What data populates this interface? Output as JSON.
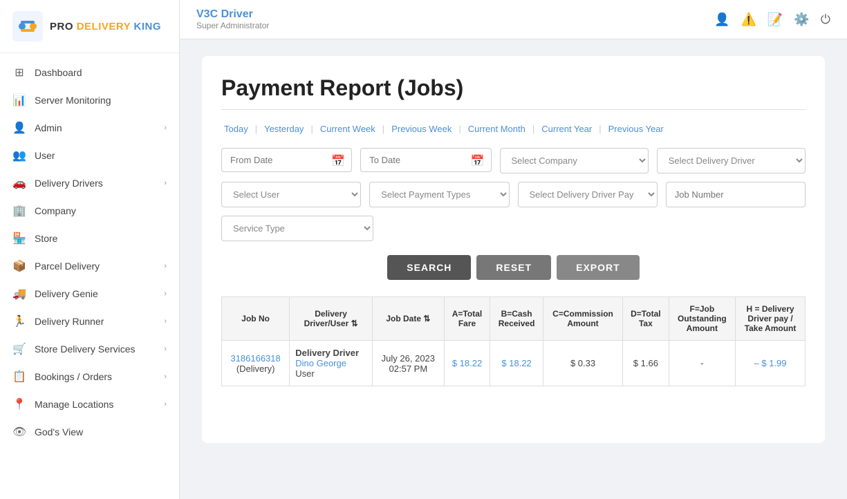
{
  "app": {
    "name_pro": "PRO",
    "name_delivery": "DELIVERY",
    "name_king": "KING"
  },
  "topbar": {
    "title": "V3C Driver",
    "subtitle": "Super Administrator"
  },
  "sidebar": {
    "items": [
      {
        "id": "dashboard",
        "label": "Dashboard",
        "icon": "⊞",
        "hasChevron": false
      },
      {
        "id": "server-monitoring",
        "label": "Server Monitoring",
        "icon": "📊",
        "hasChevron": false
      },
      {
        "id": "admin",
        "label": "Admin",
        "icon": "👤",
        "hasChevron": true
      },
      {
        "id": "user",
        "label": "User",
        "icon": "👥",
        "hasChevron": false
      },
      {
        "id": "delivery-drivers",
        "label": "Delivery Drivers",
        "icon": "🚗",
        "hasChevron": true
      },
      {
        "id": "company",
        "label": "Company",
        "icon": "🏢",
        "hasChevron": false
      },
      {
        "id": "store",
        "label": "Store",
        "icon": "🏪",
        "hasChevron": false
      },
      {
        "id": "parcel-delivery",
        "label": "Parcel Delivery",
        "icon": "📦",
        "hasChevron": true
      },
      {
        "id": "delivery-genie",
        "label": "Delivery Genie",
        "icon": "🚚",
        "hasChevron": true
      },
      {
        "id": "delivery-runner",
        "label": "Delivery Runner",
        "icon": "🏃",
        "hasChevron": true
      },
      {
        "id": "store-delivery-services",
        "label": "Store Delivery Services",
        "icon": "🛒",
        "hasChevron": true
      },
      {
        "id": "bookings-orders",
        "label": "Bookings / Orders",
        "icon": "📋",
        "hasChevron": true
      },
      {
        "id": "manage-locations",
        "label": "Manage Locations",
        "icon": "📍",
        "hasChevron": true
      },
      {
        "id": "gods-view",
        "label": "God's View",
        "icon": "👁",
        "hasChevron": false
      }
    ]
  },
  "page": {
    "title": "Payment Report (Jobs)"
  },
  "date_filters": [
    {
      "id": "today",
      "label": "Today"
    },
    {
      "id": "yesterday",
      "label": "Yesterday"
    },
    {
      "id": "current-week",
      "label": "Current Week"
    },
    {
      "id": "previous-week",
      "label": "Previous Week"
    },
    {
      "id": "current-month",
      "label": "Current Month"
    },
    {
      "id": "current-year",
      "label": "Current Year"
    },
    {
      "id": "previous-year",
      "label": "Previous Year"
    }
  ],
  "filters": {
    "from_date_placeholder": "From Date",
    "to_date_placeholder": "To Date",
    "select_company_placeholder": "Select Company",
    "select_delivery_driver_placeholder": "Select Delivery Driver",
    "select_user_placeholder": "Select User",
    "select_payment_types_placeholder": "Select Payment Types",
    "select_delivery_driver_pay_placeholder": "Select Delivery Driver Pay",
    "job_number_placeholder": "Job Number",
    "service_type_placeholder": "Service Type"
  },
  "buttons": {
    "search": "SEARCH",
    "reset": "RESET",
    "export": "EXPORT"
  },
  "table": {
    "columns": [
      "Job No",
      "Delivery Driver/User",
      "Job Date",
      "A=Total Fare",
      "B=Cash Received",
      "C=Commission Amount",
      "D=Total Tax",
      "F=Job Outstanding Amount",
      "H = Delivery Driver pay / Take Amount"
    ],
    "rows": [
      {
        "job_no": "3186166318",
        "job_type": "(Delivery)",
        "driver_name": "Dino George",
        "driver_sub": "User",
        "job_date": "July 26, 2023",
        "job_time": "02:57 PM",
        "total_fare": "$ 18.22",
        "cash_received": "$ 18.22",
        "commission_amount": "$ 0.33",
        "total_tax": "$ 1.66",
        "job_outstanding": "-",
        "driver_pay": "– $ 1.99"
      }
    ]
  }
}
